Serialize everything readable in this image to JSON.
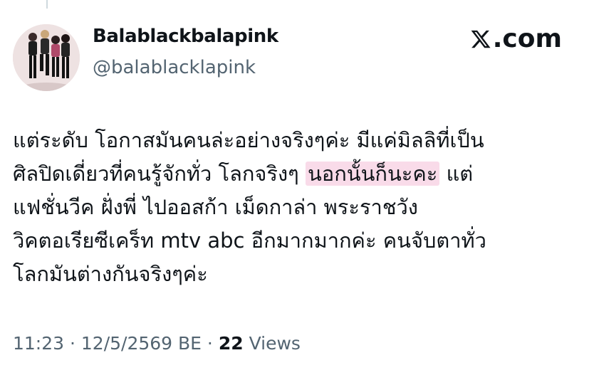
{
  "author": {
    "display_name": "Balablackbalapink",
    "handle": "@balablacklapink"
  },
  "brand": {
    "domain_label": ".com"
  },
  "tweet": {
    "line1": "แต่ระดับ โอกาสมันคนล่ะอย่างจริงๆค่ะ มีแค่มิลลิที่เป็น",
    "line2_pre": "ศิลปิดเดี่ยวที่คนรู้จักทั่ว โลกจริงๆ ",
    "line2_highlight": "นอกนั้นก็นะคะ",
    "line2_post": " แต่",
    "line3": "แฟชั่นวีค ฝั่งพี่ ไปออสก้า เม็ดกาล่า พระราชวัง",
    "line4": "วิคตอเรียซีเคร็ท mtv abc อีกมากมากค่ะ คนจับตาทั่ว",
    "line5": "โลกมันต่างกันจริงๆค่ะ",
    "highlight_color": "#f9dbe9"
  },
  "meta": {
    "time": "11:23",
    "sep1": " · ",
    "date": "12/5/2569 BE",
    "sep2": " · ",
    "views_count": "22",
    "views_label": " Views"
  }
}
